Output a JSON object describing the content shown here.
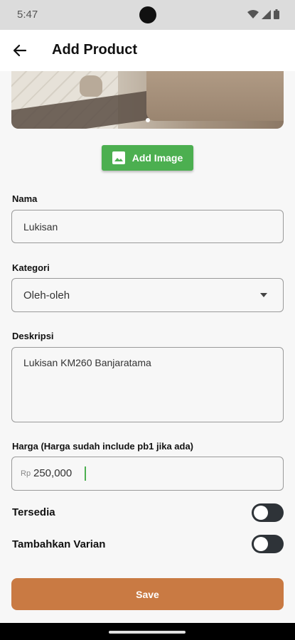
{
  "status_bar": {
    "time": "5:47"
  },
  "app_bar": {
    "title": "Add Product",
    "back_icon": "arrow-left-icon"
  },
  "hero": {
    "image_icon": "product-photo"
  },
  "add_image": {
    "label": "Add Image",
    "icon": "image-icon",
    "color": "#4caf50"
  },
  "form": {
    "nama": {
      "label": "Nama",
      "value": "Lukisan"
    },
    "kategori": {
      "label": "Kategori",
      "value": "Oleh-oleh"
    },
    "deskripsi": {
      "label": "Deskripsi",
      "value": "Lukisan KM260 Banjaratama"
    },
    "harga": {
      "label": "Harga (Harga sudah include pb1 jika ada)",
      "prefix": "Rp",
      "value": "250,000"
    }
  },
  "toggles": {
    "tersedia": {
      "label": "Tersedia",
      "on": false
    },
    "varian": {
      "label": "Tambahkan Varian",
      "on": false
    }
  },
  "save": {
    "label": "Save",
    "color": "#c97a43"
  }
}
